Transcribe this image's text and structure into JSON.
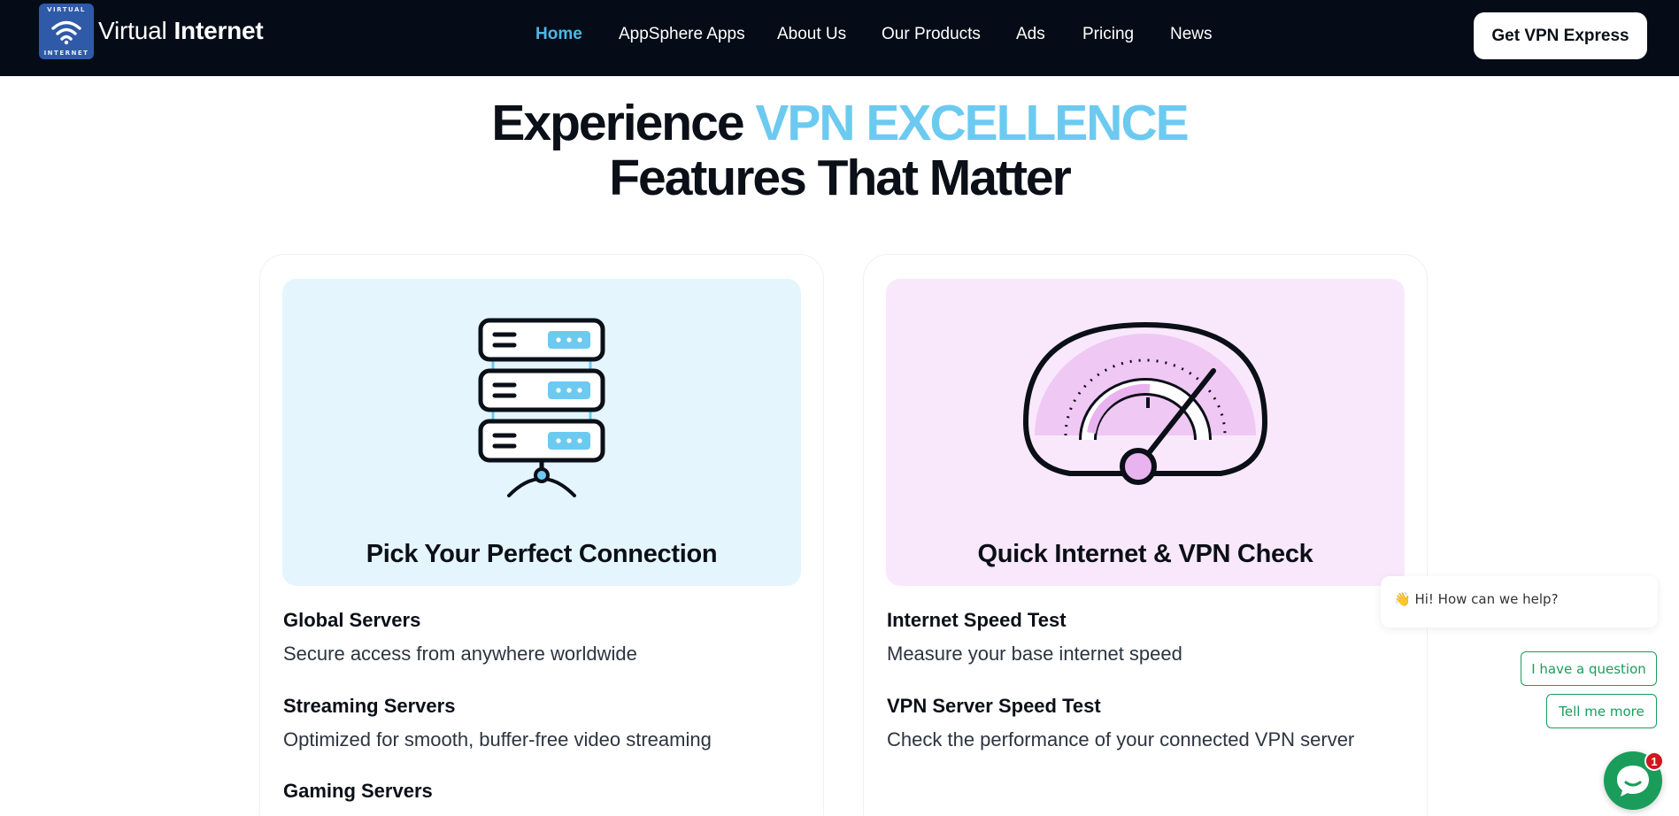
{
  "header": {
    "logo": {
      "top_text": "VIRTUAL",
      "bottom_text": "INTERNET",
      "icon": "wifi-icon"
    },
    "brand_light": "Virtual",
    "brand_bold": "Internet",
    "nav": [
      {
        "label": "Home",
        "active": true
      },
      {
        "label": "AppSphere Apps",
        "active": false
      },
      {
        "label": "About Us",
        "active": false
      },
      {
        "label": "Our Products",
        "active": false
      },
      {
        "label": "Ads",
        "active": false
      },
      {
        "label": "Pricing",
        "active": false
      },
      {
        "label": "News",
        "active": false
      }
    ],
    "cta_label": "Get VPN Express"
  },
  "hero": {
    "line1_prefix": "Experience",
    "line1_accent": "VPN EXCELLENCE",
    "line2": "Features That Matter"
  },
  "cards": [
    {
      "icon": "server-icon",
      "title": "Pick Your Perfect Connection",
      "features": [
        {
          "title": "Global Servers",
          "desc": "Secure access from anywhere worldwide"
        },
        {
          "title": "Streaming Servers",
          "desc": "Optimized for smooth, buffer-free video streaming"
        },
        {
          "title": "Gaming Servers",
          "desc": ""
        }
      ]
    },
    {
      "icon": "speedometer-icon",
      "title": "Quick Internet & VPN Check",
      "features": [
        {
          "title": "Internet Speed Test",
          "desc": "Measure your base internet speed"
        },
        {
          "title": "VPN Server Speed Test",
          "desc": "Check the performance of your connected VPN server"
        }
      ]
    }
  ],
  "chat": {
    "greeting": "👋 Hi! How can we help?",
    "options": [
      "I have a question",
      "Tell me more"
    ],
    "badge_count": "1"
  },
  "colors": {
    "header_bg": "#050c17",
    "accent": "#6ccaf0",
    "nav_active": "#4cb8e8",
    "panel_blue": "#e4f5fd",
    "panel_pink": "#f9e8fc",
    "chat_green": "#1a9d5a"
  }
}
